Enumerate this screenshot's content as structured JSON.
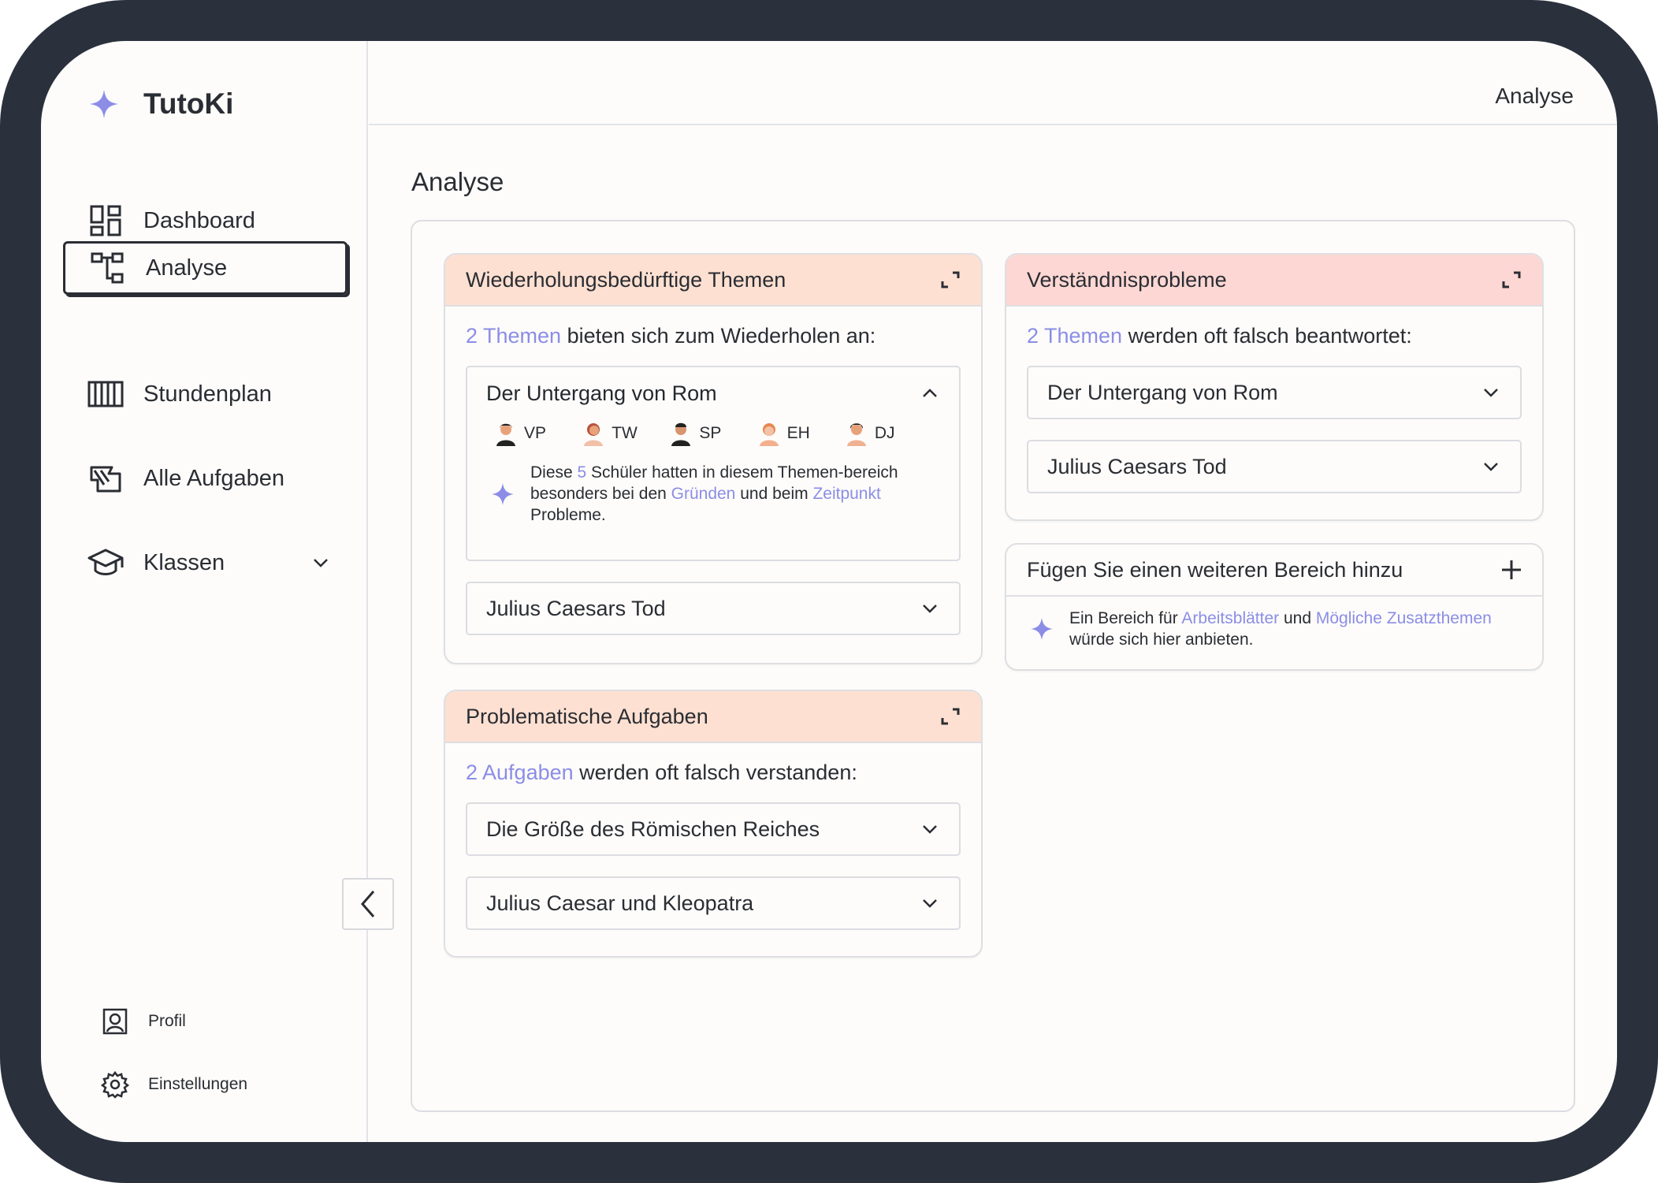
{
  "app": {
    "name": "TutoKi"
  },
  "sidebar": {
    "items": [
      {
        "label": "Dashboard",
        "icon": "dashboard-icon"
      },
      {
        "label": "Analyse",
        "icon": "hierarchy-icon"
      },
      {
        "label": "Stundenplan",
        "icon": "schedule-icon"
      },
      {
        "label": "Alle Aufgaben",
        "icon": "tasks-icon"
      },
      {
        "label": "Klassen",
        "icon": "graduation-cap-icon"
      }
    ],
    "bottom": [
      {
        "label": "Profil",
        "icon": "profile-icon"
      },
      {
        "label": "Einstellungen",
        "icon": "gear-icon"
      }
    ]
  },
  "header": {
    "breadcrumb": "Analyse"
  },
  "page": {
    "title": "Analyse"
  },
  "cards": {
    "review": {
      "title": "Wiederholungsbedürftige Themen",
      "lead_count": "2 Themen",
      "lead_rest": " bieten sich zum Wiederholen an:",
      "open_topic": "Der Untergang von Rom",
      "students": [
        "VP",
        "TW",
        "SP",
        "EH",
        "DJ"
      ],
      "hint": {
        "p1": "Diese ",
        "count": "5",
        "p2": " Schüler hatten in diesem Themen-bereich besonders bei den ",
        "link1": "Gründen",
        "p3": " und beim ",
        "link2": "Zeitpunkt",
        "p4": " Probleme."
      },
      "closed_topics": [
        "Julius Caesars Tod"
      ]
    },
    "understanding": {
      "title": "Verständnisprobleme",
      "lead_count": "2 Themen",
      "lead_rest": " werden oft falsch beantwortet:",
      "topics": [
        "Der Untergang von Rom",
        "Julius Caesars Tod"
      ]
    },
    "tasks": {
      "title": "Problematische Aufgaben",
      "lead_count": "2 Aufgaben",
      "lead_rest": " werden oft falsch verstanden:",
      "topics": [
        "Die Größe des Römischen Reiches",
        "Julius Caesar und Kleopatra"
      ]
    },
    "add": {
      "title": "Fügen Sie einen weiteren Bereich hinzu",
      "hint": {
        "p1": "Ein Bereich für ",
        "link1": "Arbeitsblätter",
        "p2": " und ",
        "link2": "Mögliche Zusatzthemen",
        "p3": " würde sich hier anbieten."
      }
    }
  },
  "colors": {
    "accent": "#8b8de6",
    "orange_header": "#fde0d1",
    "pink_header": "#fdd7d3",
    "frame": "#2a313d"
  }
}
